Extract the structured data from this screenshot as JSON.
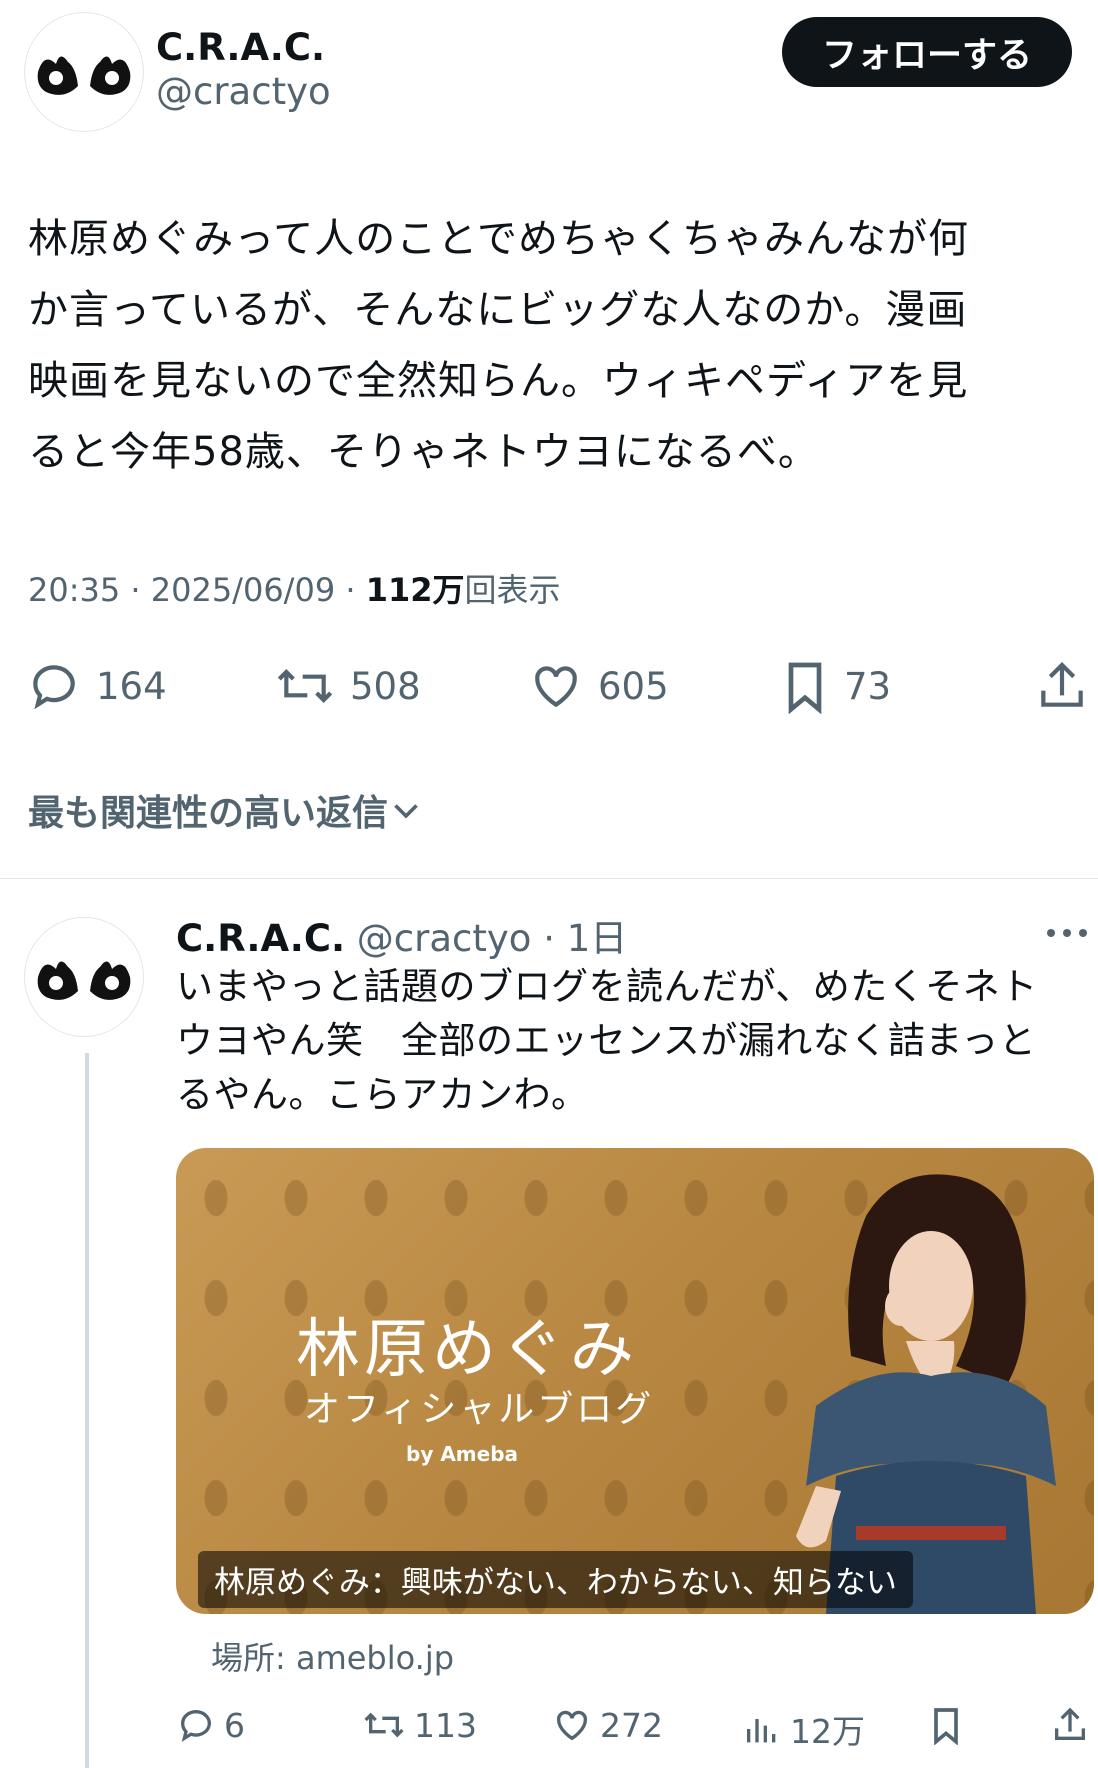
{
  "main_tweet": {
    "author_name": "C.R.A.C.",
    "author_handle": "@cractyo",
    "follow_label": "フォローする",
    "text": "林原めぐみって人のことでめちゃくちゃみんなが何\nか言っているが、そんなにビッグな人なのか。漫画\n映画を見ないので全然知らん。ウィキペディアを見\nると今年58歳、そりゃネトウヨになるべ。",
    "time": "20:35 · 2025/06/09 · ",
    "views_count": "112万",
    "views_label": "回表示",
    "replies": "164",
    "retweets": "508",
    "likes": "605",
    "bookmarks": "73"
  },
  "sort_label": "最も関連性の高い返信",
  "reply": {
    "author_name": "C.R.A.C.",
    "author_handle": "@cractyo",
    "age": "· 1日",
    "text": "いまやっと話題のブログを読んだが、めたくそネト\nウヨやん笑　全部のエッセンスが漏れなく詰まっと\nるやん。こらアカンわ。",
    "card": {
      "title": "林原めぐみ",
      "subtitle": "オフィシャルブログ",
      "by": "by Ameba",
      "caption": "林原めぐみ：興味がない、わからない、知らない"
    },
    "source": "場所: ameblo.jp",
    "replies": "6",
    "retweets": "113",
    "likes": "272",
    "views": "12万"
  },
  "colors": {
    "text": "#0f1419",
    "muted": "#536471",
    "button_bg": "#0f1419",
    "card_gold": "#b88843"
  }
}
